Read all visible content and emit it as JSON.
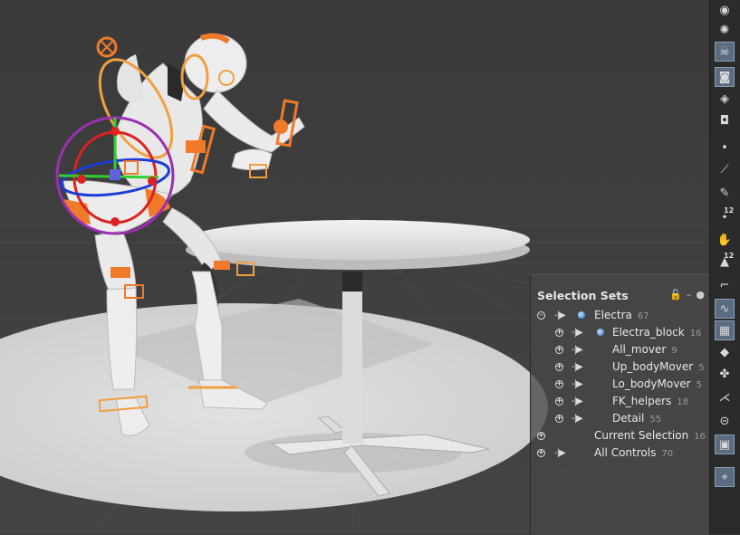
{
  "panel": {
    "title": "Selection Sets",
    "rows": [
      {
        "label": "Electra",
        "count": "67"
      },
      {
        "label": "Electra_block",
        "count": "16"
      },
      {
        "label": "All_mover",
        "count": "9"
      },
      {
        "label": "Up_bodyMover",
        "count": "5"
      },
      {
        "label": "Lo_bodyMover",
        "count": "5"
      },
      {
        "label": "FK_helpers",
        "count": "18"
      },
      {
        "label": "Detail",
        "count": "55"
      },
      {
        "label": "Current Selection",
        "count": "16"
      },
      {
        "label": "All Controls",
        "count": "70"
      }
    ]
  },
  "toolbar": {
    "badge_a": "12",
    "badge_b": "12"
  },
  "colors": {
    "accent_orange": "#f07a2a",
    "control_orange": "#f0a040",
    "viewport_bg": "#3a3a3a",
    "panel_bg": "#464646"
  }
}
